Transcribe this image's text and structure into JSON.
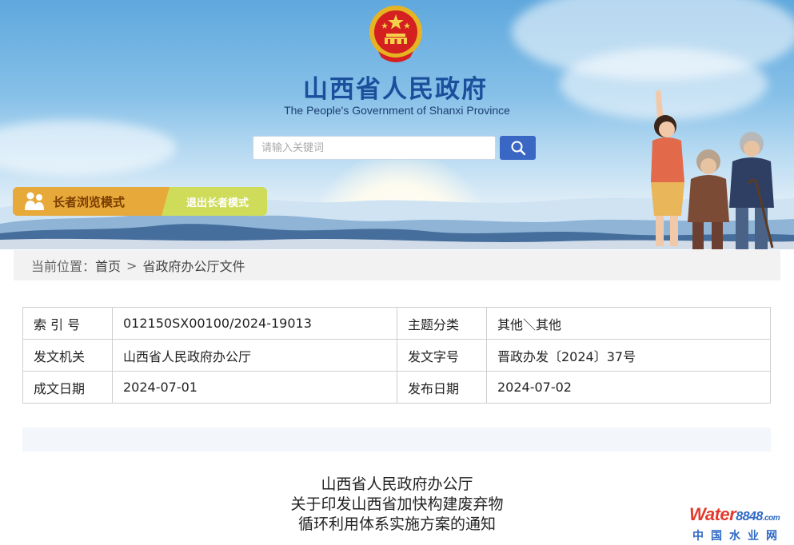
{
  "header": {
    "title": "山西省人民政府",
    "subtitle": "The People's Government of Shanxi Province",
    "emblem_icon": "national-emblem-icon"
  },
  "search": {
    "placeholder": "请输入关键词",
    "button_icon": "search-icon"
  },
  "elder_mode": {
    "mode_label": "长者浏览模式",
    "exit_label": "退出长者模式",
    "mode_icon": "elder-people-icon"
  },
  "breadcrumb": {
    "prefix": "当前位置：",
    "items": [
      "首页",
      "省政府办公厅文件"
    ],
    "separator": ">"
  },
  "meta": {
    "rows": [
      {
        "k1": "索 引 号",
        "v1": "012150SX00100/2024-19013",
        "k2": "主题分类",
        "v2": "其他＼其他"
      },
      {
        "k1": "发文机关",
        "v1": "山西省人民政府办公厅",
        "k2": "发文字号",
        "v2": "晋政办发〔2024〕37号"
      },
      {
        "k1": "成文日期",
        "v1": "2024-07-01",
        "k2": "发布日期",
        "v2": "2024-07-02"
      }
    ]
  },
  "document": {
    "title_lines": [
      "山西省人民政府办公厅",
      "关于印发山西省加快构建废弃物",
      "循环利用体系实施方案的通知"
    ]
  },
  "watermark": {
    "brand": "Water",
    "brand_num": "8848",
    "brand_suffix": ".com",
    "chinese": "中国水业网"
  },
  "colors": {
    "title_blue": "#1a4f9c",
    "search_button": "#3a66c4",
    "elder_orange": "#e7a93a",
    "elder_green": "#cfdc5a"
  }
}
